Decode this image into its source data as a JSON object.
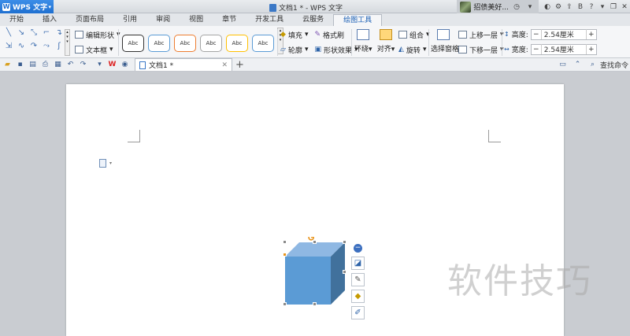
{
  "app": {
    "name": "WPS 文字",
    "window_title": "文档1 * - WPS 文字",
    "user_name": "招债美好..."
  },
  "ribbon_tabs": [
    {
      "label": "开始",
      "active": false
    },
    {
      "label": "插入",
      "active": false
    },
    {
      "label": "页面布局",
      "active": false
    },
    {
      "label": "引用",
      "active": false
    },
    {
      "label": "审阅",
      "active": false
    },
    {
      "label": "视图",
      "active": false
    },
    {
      "label": "章节",
      "active": false
    },
    {
      "label": "开发工具",
      "active": false
    },
    {
      "label": "云服务",
      "active": false
    },
    {
      "label": "绘图工具",
      "active": true
    }
  ],
  "ribbon": {
    "edit_shape": "编辑形状",
    "text_box": "文本框",
    "style_presets": [
      "Abc",
      "Abc",
      "Abc",
      "Abc",
      "Abc",
      "Abc"
    ],
    "style_colors": [
      "#333333",
      "#5a9bd5",
      "#ed7d31",
      "#a5a5a5",
      "#ffc000",
      "#5b9bd5"
    ],
    "fill": "填充",
    "format_painter": "格式刷",
    "outline": "轮廓",
    "shape_effects": "形状效果",
    "wrap": "环绕",
    "align": "对齐",
    "group": "组合",
    "rotate": "旋转",
    "selection_pane": "选择窗格",
    "bring_forward": "上移一层",
    "send_backward": "下移一层",
    "height_label": "高度:",
    "height_value": "2.54厘米",
    "width_label": "宽度:",
    "width_value": "2.54厘米"
  },
  "quick_access": {
    "doc_tab": "文档1 *",
    "find_command": "查找命令"
  },
  "shape": {
    "type": "cube",
    "front_color": "#5b9bd5",
    "top_color": "#8fb8e3",
    "side_color": "#41719c"
  },
  "watermark": "软件技巧"
}
